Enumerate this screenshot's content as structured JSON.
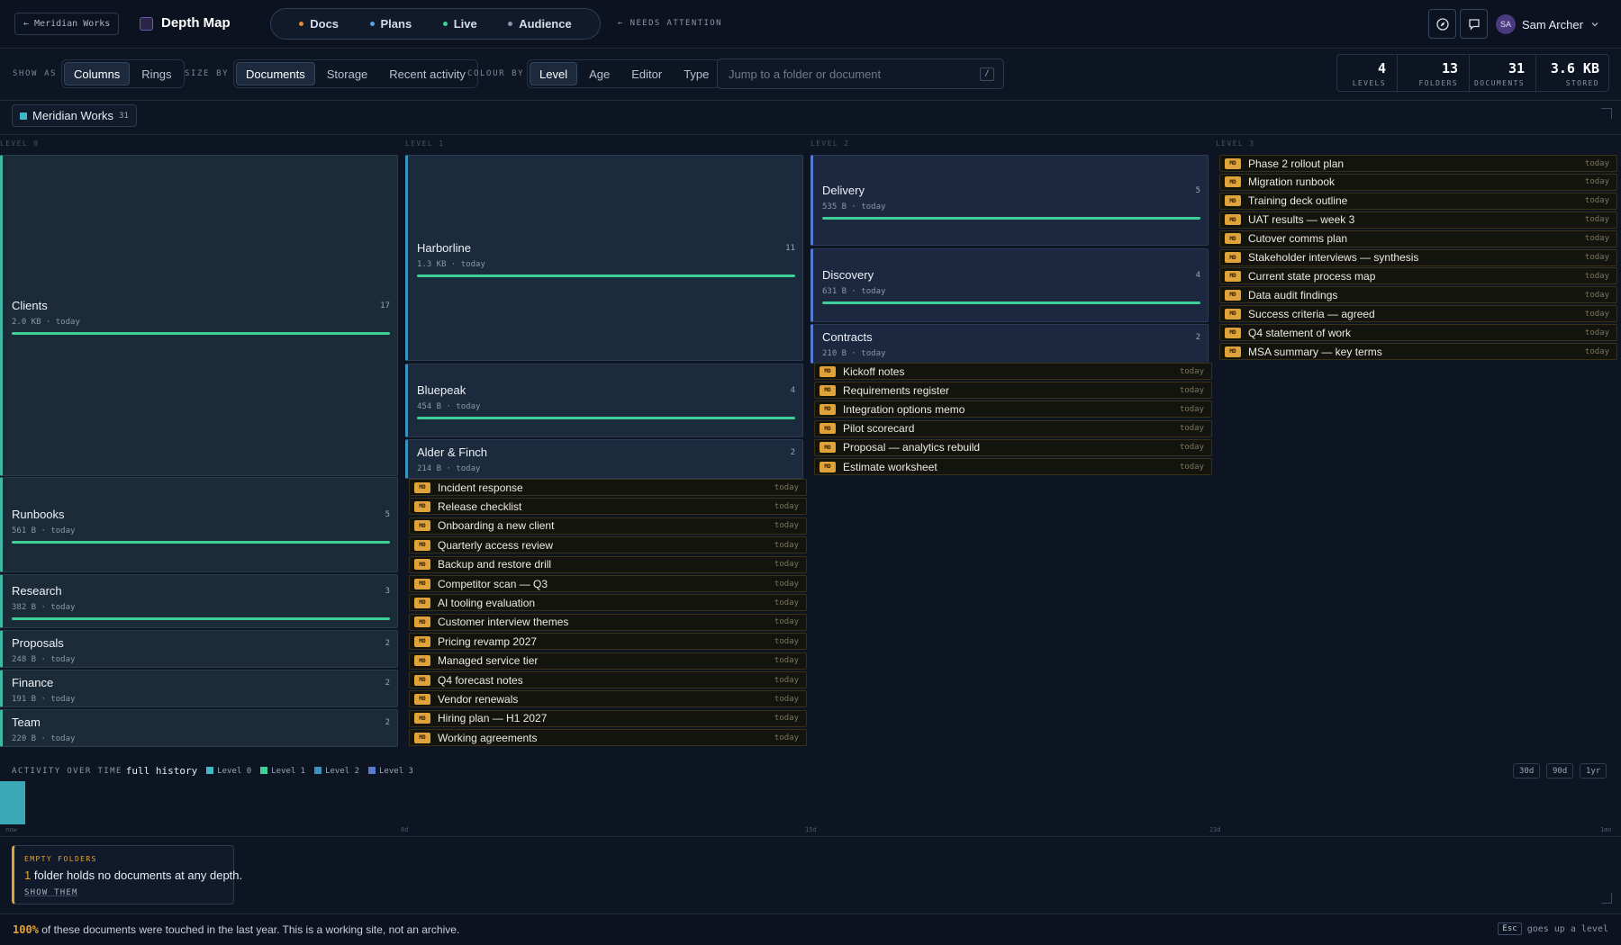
{
  "topbar": {
    "back_label": "← Meridian Works",
    "app_title": "Depth Map",
    "tabs": [
      {
        "label": "Docs",
        "dot": "#e08a3a"
      },
      {
        "label": "Plans",
        "dot": "#5aa0e0"
      },
      {
        "label": "Live",
        "dot": "#3fcf98"
      },
      {
        "label": "Audience",
        "dot": "#8a93a8"
      }
    ],
    "needs_attention": "← NEEDS ATTENTION",
    "user": {
      "initials": "SA",
      "name": "Sam Archer"
    },
    "icons": [
      "compass-icon",
      "comment-icon",
      "chevron-down-icon"
    ]
  },
  "toolbar": {
    "show_as": {
      "label": "SHOW AS",
      "options": [
        "Columns",
        "Rings"
      ],
      "selected": "Columns"
    },
    "size_by": {
      "label": "SIZE BY",
      "options": [
        "Documents",
        "Storage",
        "Recent activity"
      ],
      "selected": "Documents"
    },
    "colour_by": {
      "label": "COLOUR BY",
      "options": [
        "Level",
        "Age",
        "Editor",
        "Type"
      ],
      "selected": "Level"
    },
    "search": {
      "placeholder": "Jump to a folder or document",
      "shortcut": "/"
    },
    "stats": [
      {
        "value": "4",
        "label": "LEVELS"
      },
      {
        "value": "13",
        "label": "FOLDERS"
      },
      {
        "value": "31",
        "label": "DOCUMENTS"
      },
      {
        "value": "3.6 KB",
        "label": "STORED"
      }
    ]
  },
  "breadcrumb": {
    "label": "Meridian Works",
    "count": "31"
  },
  "levels": [
    "LEVEL 0",
    "LEVEL 1",
    "LEVEL 2",
    "LEVEL 3"
  ],
  "level0": [
    {
      "name": "Clients",
      "count": "17",
      "meta": "2.0 KB · today"
    },
    {
      "name": "Runbooks",
      "count": "5",
      "meta": "561 B · today"
    },
    {
      "name": "Research",
      "count": "3",
      "meta": "382 B · today"
    },
    {
      "name": "Proposals",
      "count": "2",
      "meta": "248 B · today"
    },
    {
      "name": "Finance",
      "count": "2",
      "meta": "191 B · today"
    },
    {
      "name": "Team",
      "count": "2",
      "meta": "220 B · today"
    }
  ],
  "level1": [
    {
      "name": "Harborline",
      "count": "11",
      "meta": "1.3 KB · today"
    },
    {
      "name": "Bluepeak",
      "count": "4",
      "meta": "454 B · today"
    },
    {
      "name": "Alder & Finch",
      "count": "2",
      "meta": "214 B · today"
    }
  ],
  "level1_docs": [
    "Incident response",
    "Release checklist",
    "Onboarding a new client",
    "Quarterly access review",
    "Backup and restore drill",
    "Competitor scan — Q3",
    "AI tooling evaluation",
    "Customer interview themes",
    "Pricing revamp 2027",
    "Managed service tier",
    "Q4 forecast notes",
    "Vendor renewals",
    "Hiring plan — H1 2027",
    "Working agreements"
  ],
  "level2": [
    {
      "name": "Delivery",
      "count": "5",
      "meta": "535 B · today"
    },
    {
      "name": "Discovery",
      "count": "4",
      "meta": "631 B · today"
    },
    {
      "name": "Contracts",
      "count": "2",
      "meta": "210 B · today"
    }
  ],
  "level2_docs": [
    "Kickoff notes",
    "Requirements register",
    "Integration options memo",
    "Pilot scorecard",
    "Proposal — analytics rebuild",
    "Estimate worksheet"
  ],
  "level3_docs": [
    "Phase 2 rollout plan",
    "Migration runbook",
    "Training deck outline",
    "UAT results — week 3",
    "Cutover comms plan",
    "Stakeholder interviews — synthesis",
    "Current state process map",
    "Data audit findings",
    "Success criteria — agreed",
    "Q4 statement of work",
    "MSA summary — key terms"
  ],
  "doc_tag": "MD",
  "doc_date": "today",
  "activity": {
    "title": "ACTIVITY OVER TIME",
    "subtitle": "full history",
    "legend": [
      {
        "label": "Level 0",
        "color": "#3fb8c8"
      },
      {
        "label": "Level 1",
        "color": "#3fcf98"
      },
      {
        "label": "Level 2",
        "color": "#3a93bf"
      },
      {
        "label": "Level 3",
        "color": "#5a79d2"
      }
    ],
    "ranges": [
      "30d",
      "90d",
      "1yr"
    ],
    "axis": [
      "now",
      "8d",
      "15d",
      "23d",
      "1mo"
    ]
  },
  "notice": {
    "title": "EMPTY FOLDERS",
    "count": "1",
    "text": "folder holds no documents at any depth.",
    "action": "SHOW THEM"
  },
  "footer": {
    "percent": "100%",
    "text": "of these documents were touched in the last year. This is a working site, not an archive.",
    "key": "Esc",
    "hint": "goes up a level"
  }
}
